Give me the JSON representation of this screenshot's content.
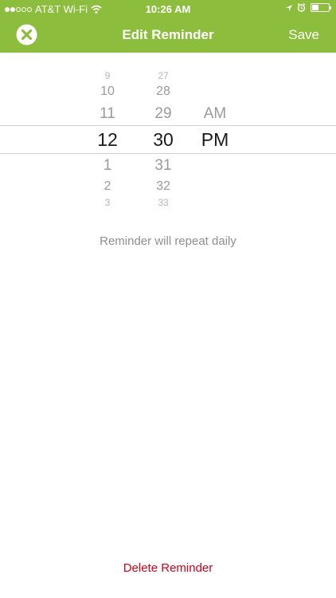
{
  "status_bar": {
    "carrier": "AT&T Wi-Fi",
    "time": "10:26 AM",
    "signal_filled": 2,
    "signal_total": 5,
    "battery_level": 0.4
  },
  "nav": {
    "title": "Edit Reminder",
    "save_label": "Save",
    "close_icon": "close-circle-icon"
  },
  "picker": {
    "hours": [
      "9",
      "10",
      "11",
      "12",
      "1",
      "2",
      "3"
    ],
    "minutes": [
      "27",
      "28",
      "29",
      "30",
      "31",
      "32",
      "33"
    ],
    "ampm": [
      "AM",
      "PM"
    ],
    "selected": {
      "hour": "12",
      "minute": "30",
      "ampm": "PM"
    }
  },
  "repeat_text": "Reminder will repeat daily",
  "delete_label": "Delete Reminder",
  "colors": {
    "header": "#8dbd3c",
    "delete": "#d0021b"
  }
}
